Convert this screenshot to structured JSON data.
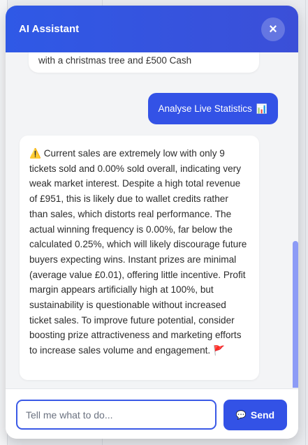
{
  "header": {
    "title": "AI Assistant",
    "close_glyph": "×",
    "close_icon": "close-icon"
  },
  "messages": {
    "previous_snippet": "with a christmas tree and £500 Cash",
    "user_message": {
      "text": "Analyse Live Statistics",
      "icon": "bar-chart-icon",
      "emoji": "📊"
    },
    "assistant_message": {
      "lead_icon": "warning-icon",
      "lead_emoji": "⚠️",
      "text": "Current sales are extremely low with only 9 tickets sold and 0.00% sold overall, indicating very weak market interest. Despite a high total revenue of £951, this is likely due to wallet credits rather than sales, which distorts real performance. The actual winning frequency is 0.00%, far below the calculated 0.25%, which will likely discourage future buyers expecting wins. Instant prizes are minimal (average value £0.01), offering little incentive. Profit margin appears artificially high at 100%, but sustainability is questionable without increased ticket sales. To improve future potential, consider boosting prize attractiveness and marketing efforts to increase sales volume and engagement.",
      "trail_icon": "red-flag-icon",
      "trail_emoji": "🚩"
    }
  },
  "composer": {
    "placeholder": "Tell me what to do...",
    "value": "",
    "send_label": "Send",
    "send_icon": "chat-bubble-icon",
    "send_emoji": "💬"
  },
  "colors": {
    "primary": "#3352e6",
    "header_gradient_start": "#2f59e6",
    "scrollbar": "#8c9bf6"
  }
}
